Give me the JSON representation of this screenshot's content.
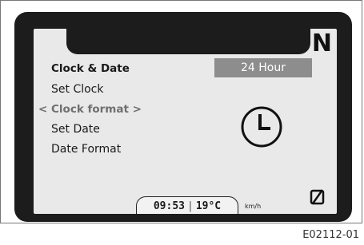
{
  "display": {
    "gear_indicator": "N",
    "menu": {
      "title": "Clock & Date",
      "items": [
        {
          "label": "Set Clock"
        },
        {
          "label": "< Clock format >",
          "selected": true
        },
        {
          "label": "Set Date"
        },
        {
          "label": "Date Format"
        }
      ]
    },
    "selected_value": "24 Hour",
    "icon": "clock-icon",
    "status_bar": {
      "time": "09:53",
      "separator": "|",
      "temperature": "19°C",
      "speed_unit": "km/h"
    },
    "trip_icon": "empty-set-icon"
  },
  "caption": "E02112-01",
  "colors": {
    "bezel": "#1c1c1c",
    "screen_bg": "#e9e9e9",
    "value_box_bg": "#8d8d8d",
    "selected_text": "#6f6f6f"
  }
}
